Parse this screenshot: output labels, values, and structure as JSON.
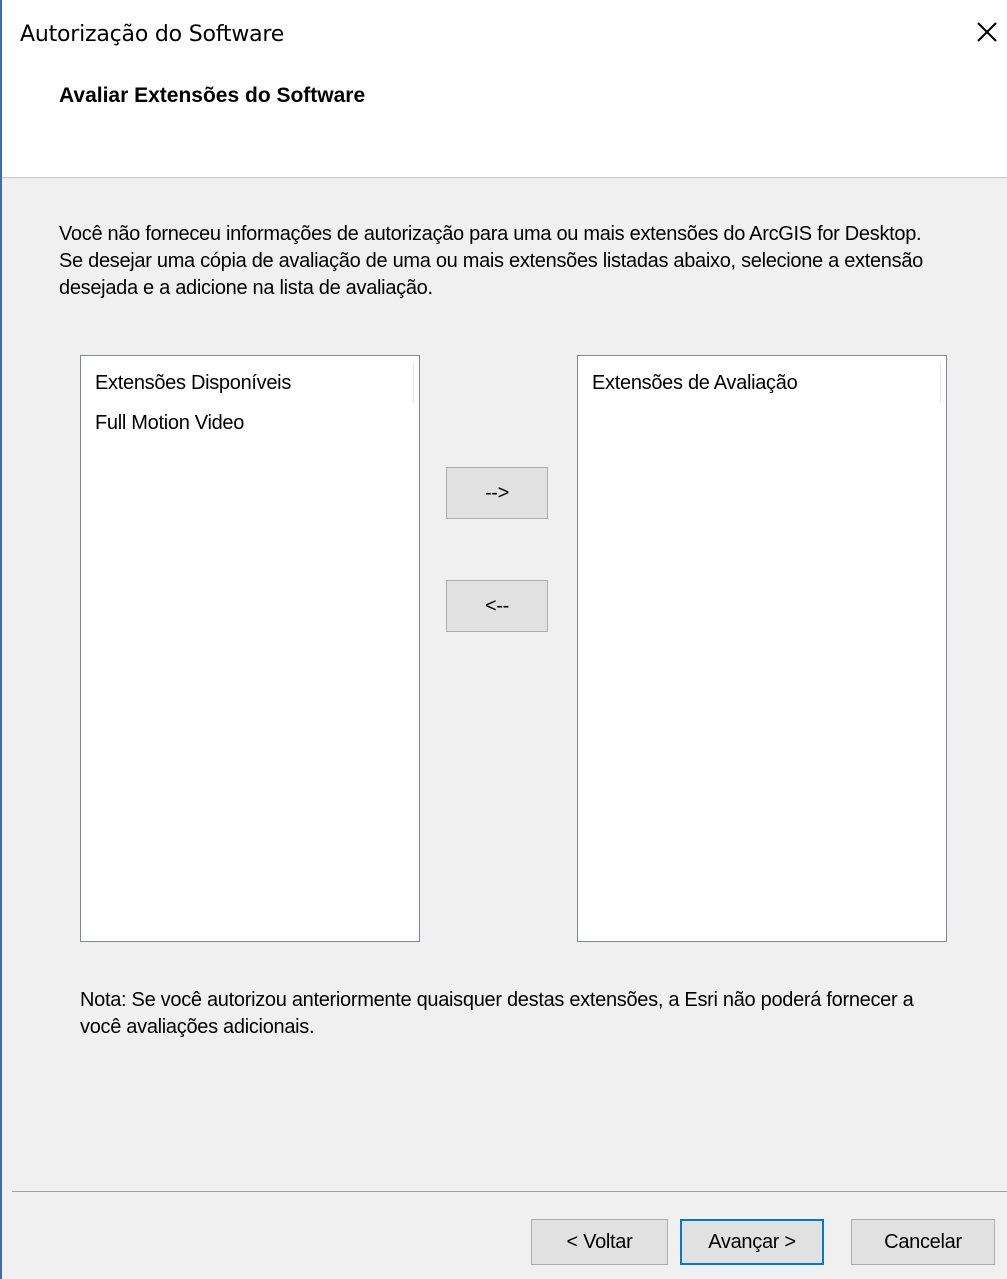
{
  "window": {
    "title": "Autorização do Software"
  },
  "header": {
    "heading": "Avaliar Extensões do Software"
  },
  "intro_text": "Você não forneceu informações de autorização para uma ou mais extensões do ArcGIS for Desktop. Se desejar uma cópia de avaliação de uma ou mais extensões listadas abaixo, selecione a extensão desejada e a adicione na lista de avaliação.",
  "available_list": {
    "header": "Extensões Disponíveis",
    "items": [
      "Full Motion Video"
    ]
  },
  "evaluation_list": {
    "header": "Extensões de Avaliação",
    "items": []
  },
  "transfer_buttons": {
    "add_label": "-->",
    "remove_label": "<--"
  },
  "note_text": "Nota:  Se você autorizou anteriormente quaisquer destas extensões, a Esri não poderá fornecer a você avaliações adicionais.",
  "footer": {
    "back_label": "< Voltar",
    "next_label": "Avançar >",
    "cancel_label": "Cancelar"
  },
  "icons": {
    "close": "close-icon"
  },
  "colors": {
    "focus_border": "#0078d7",
    "window_border": "#3c6fa8"
  }
}
